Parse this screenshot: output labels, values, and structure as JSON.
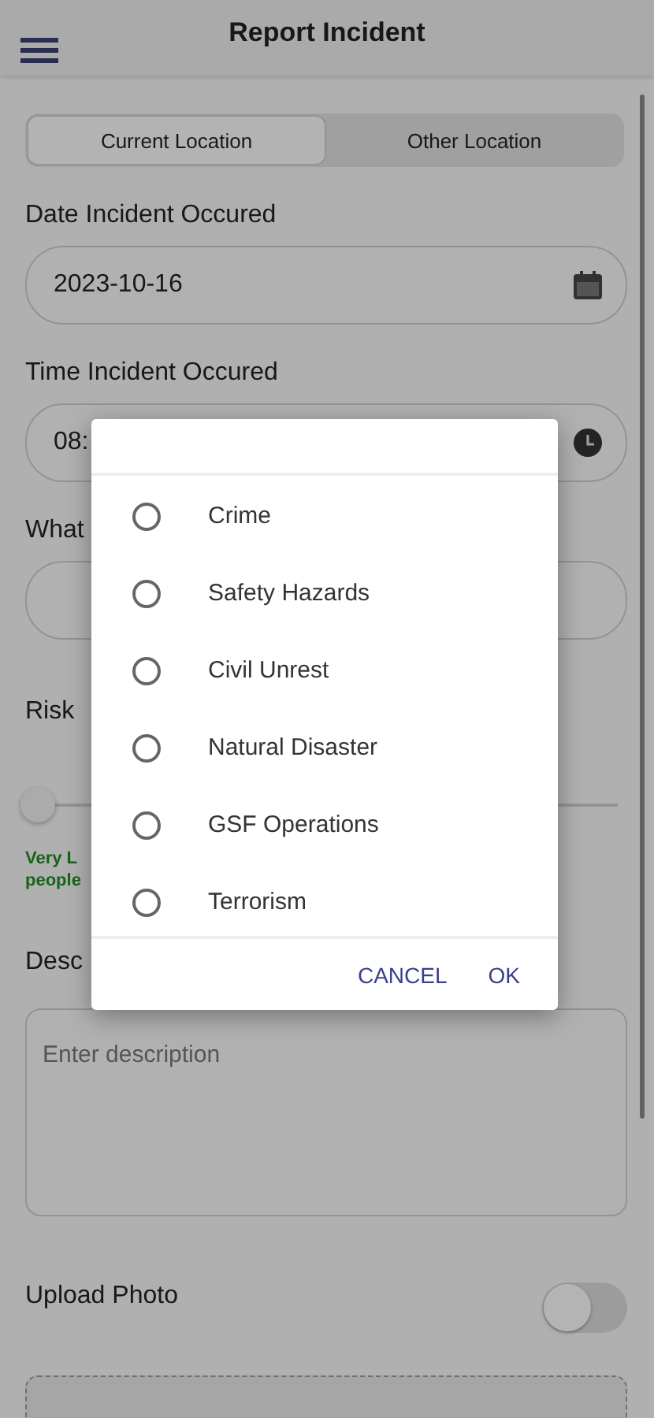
{
  "header": {
    "title": "Report Incident"
  },
  "location_tabs": [
    {
      "label": "Current Location",
      "selected": true
    },
    {
      "label": "Other Location",
      "selected": false
    }
  ],
  "date_field": {
    "label": "Date Incident Occured",
    "value": "2023-10-16"
  },
  "time_field": {
    "label": "Time Incident Occured",
    "value": "08:"
  },
  "type_field": {
    "label": "What"
  },
  "risk": {
    "label": "Risk",
    "level": 0,
    "description": [
      "Very L",
      "people"
    ]
  },
  "description": {
    "label": "Desc",
    "placeholder": "Enter description"
  },
  "upload_photo": {
    "label": "Upload Photo",
    "on": false
  },
  "dialog": {
    "options": [
      {
        "label": "Crime",
        "selected": false
      },
      {
        "label": "Safety Hazards",
        "selected": false
      },
      {
        "label": "Civil Unrest",
        "selected": false
      },
      {
        "label": "Natural Disaster",
        "selected": false
      },
      {
        "label": "GSF Operations",
        "selected": false
      },
      {
        "label": "Terrorism",
        "selected": false
      }
    ],
    "buttons": [
      "CANCEL",
      "OK"
    ]
  }
}
